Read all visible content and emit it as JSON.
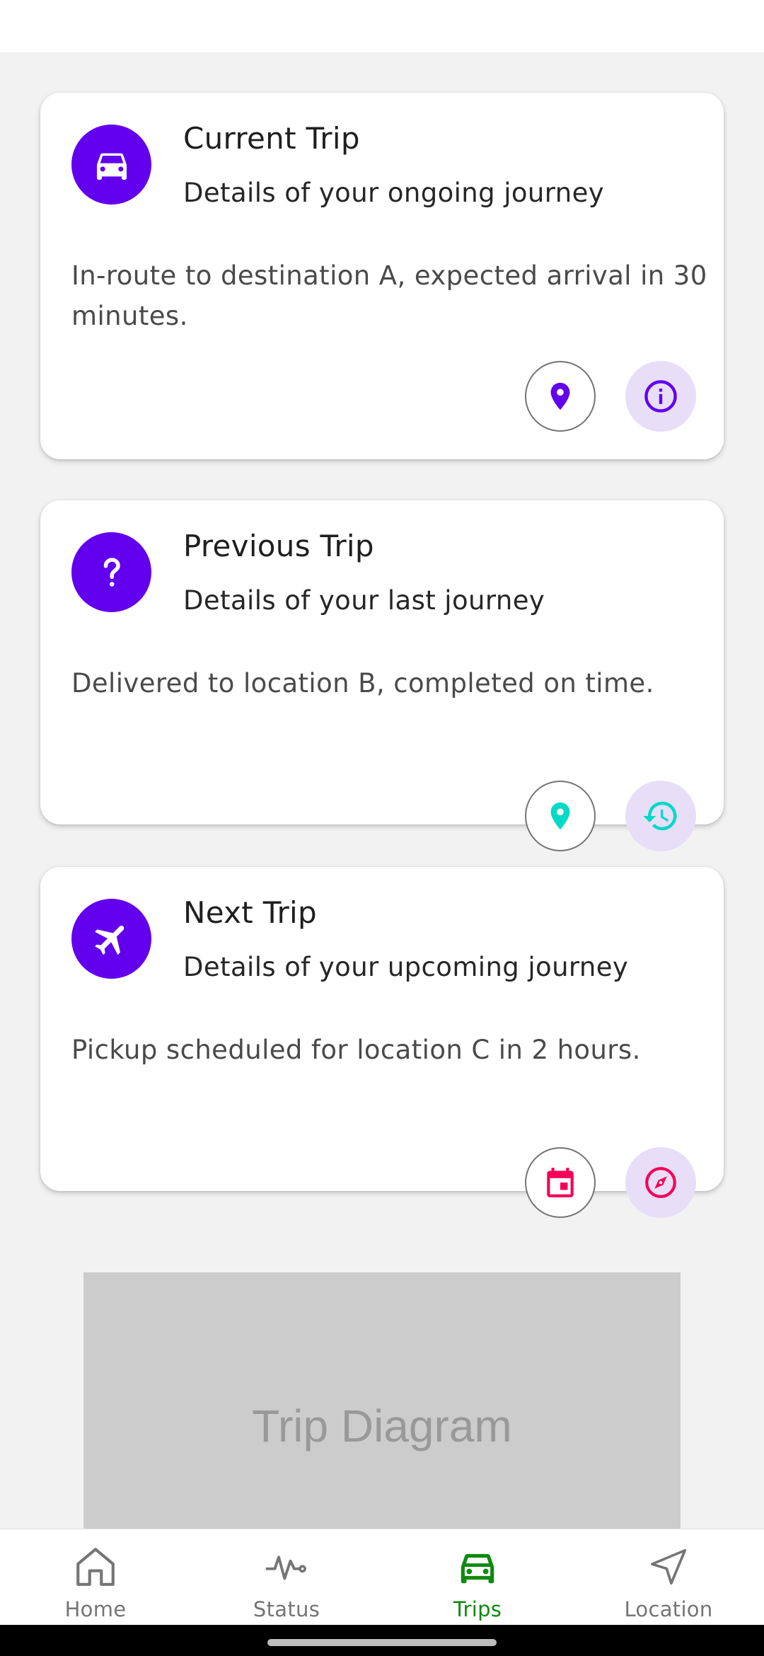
{
  "colors": {
    "primary": "#6200ee",
    "teal": "#03dac5",
    "pink": "#f50057",
    "tonal_bg": "#e8def8",
    "nav_active": "#0f8a0f"
  },
  "cards": [
    {
      "icon": "car-icon",
      "title": "Current Trip",
      "subtitle": "Details of your ongoing journey",
      "body": "In-route to destination A, expected arrival in 30 minutes.",
      "actions": [
        "location-pin-icon",
        "info-icon"
      ]
    },
    {
      "icon": "question-mark-icon",
      "title": "Previous Trip",
      "subtitle": "Details of your last journey",
      "body": "Delivered to location B, completed on time.",
      "actions": [
        "location-pin-icon",
        "history-icon"
      ]
    },
    {
      "icon": "airplane-icon",
      "title": "Next Trip",
      "subtitle": "Details of your upcoming journey",
      "body": "Pickup scheduled for location C in 2 hours.",
      "actions": [
        "calendar-icon",
        "compass-icon"
      ]
    }
  ],
  "diagram": {
    "label": "Trip Diagram"
  },
  "nav": {
    "items": [
      {
        "label": "Home",
        "icon": "home-icon",
        "active": false
      },
      {
        "label": "Status",
        "icon": "pulse-icon",
        "active": false
      },
      {
        "label": "Trips",
        "icon": "car-icon",
        "active": true
      },
      {
        "label": "Location",
        "icon": "navigation-arrow-icon",
        "active": false
      }
    ]
  }
}
